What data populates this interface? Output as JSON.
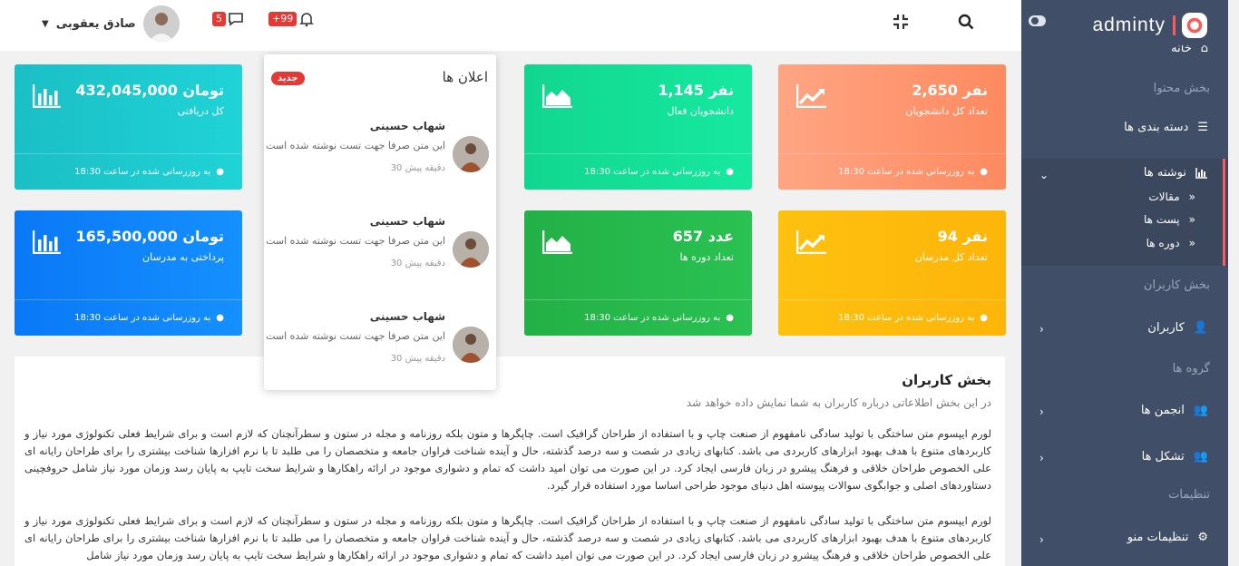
{
  "header": {
    "user_name": "صادق یعقوبی",
    "messages_count": "5",
    "notifications_count": "+99"
  },
  "sidebar": {
    "logo": "adminty",
    "home": "خانه",
    "section_content": "بخش محتوا",
    "categories": "دسته بندی ها",
    "posts": "نوشته ها",
    "sub_articles": "مقالات",
    "sub_posts": "پست ها",
    "sub_courses": "دوره ها",
    "section_users": "بخش کاربران",
    "users": "کاربران",
    "section_groups": "گروه ها",
    "forums": "انجمن ها",
    "organizations": "تشکل ها",
    "section_settings": "تنظیمات",
    "menu_settings": "تنظیمات منو"
  },
  "cards": [
    {
      "value": "432,045,000 تومان",
      "label": "کل دریافتی",
      "footer": "به روزرسانی شده در ساعت 18:30",
      "color": "#10c7cc"
    },
    {
      "value": "1,145 نفر",
      "label": "دانشجویان فعال",
      "footer": "به روزرسانی شده در ساعت 18:30",
      "color": "#13dd95"
    },
    {
      "value": "2,650 نفر",
      "label": "تعداد کل دانشجویان",
      "footer": "به روزرسانی شده در ساعت 18:30",
      "color": "#fd8f6a"
    },
    {
      "value": "165,500,000 تومان",
      "label": "پرداختی به مدرسان",
      "footer": "به روزرسانی شده در ساعت 18:30",
      "color": "#0c82fb"
    },
    {
      "value": "657 عدد",
      "label": "تعداد دوره ها",
      "footer": "به روزرسانی شده در ساعت 18:30",
      "color": "#26b74c"
    },
    {
      "value": "94 نفر",
      "label": "تعداد کل مدرسان",
      "footer": "به روزرسانی شده در ساعت 18:30",
      "color": "#fdb90c"
    }
  ],
  "panel": {
    "title": "بخش کاربران",
    "subtitle": "در این بخش اطلاعاتی درباره کاربران به شما نمایش داده خواهد شد",
    "paragraph1": "لورم ایپسوم متن ساختگی با تولید سادگی نامفهوم از صنعت چاپ و با استفاده از طراحان گرافیک است. چاپگرها و متون بلکه روزنامه و مجله در ستون و سطرآنچنان که لازم است و برای شرایط فعلی تکنولوژی مورد نیاز و کاربردهای متنوع با هدف بهبود ابزارهای کاربردی می باشد. کتابهای زیادی در شصت و سه درصد گذشته، حال و آینده شناخت فراوان جامعه و متخصصان را می طلبد تا با نرم افزارها شناخت بیشتری را برای طراحان رایانه ای علی الخصوص طراحان خلاقی و فرهنگ پیشرو در زبان فارسی ایجاد کرد. در این صورت می توان امید داشت که تمام و دشواری موجود در ارائه راهکارها و شرایط سخت تایپ به پایان رسد وزمان مورد نیاز شامل حروفچینی دستاوردهای اصلی و جوابگوی سوالات پیوسته اهل دنیای موجود طراحی اساسا مورد استفاده قرار گیرد.",
    "paragraph2": "لورم ایپسوم متن ساختگی با تولید سادگی نامفهوم از صنعت چاپ و با استفاده از طراحان گرافیک است. چاپگرها و متون بلکه روزنامه و مجله در ستون و سطرآنچنان که لازم است و برای شرایط فعلی تکنولوژی مورد نیاز و کاربردهای متنوع با هدف بهبود ابزارهای کاربردی می باشد. کتابهای زیادی در شصت و سه درصد گذشته، حال و آینده شناخت فراوان جامعه و متخصصان را می طلبد تا با نرم افزارها شناخت بیشتری را برای طراحان رایانه ای علی الخصوص طراحان خلاقی و فرهنگ پیشرو در زبان فارسی ایجاد کرد. در این صورت می توان امید داشت که تمام و دشواری موجود در ارائه راهکارها و شرایط سخت تایپ به پایان رسد وزمان مورد نیاز شامل"
  },
  "notifications": {
    "title": "اعلان ها",
    "badge": "جدید",
    "items": [
      {
        "name": "شهاب حسینی",
        "text": "این متن صرفا جهت تست نوشته شده است",
        "time": "30 دقیقه پیش"
      },
      {
        "name": "شهاب حسینی",
        "text": "این متن صرفا جهت تست نوشته شده است",
        "time": "30 دقیقه پیش"
      },
      {
        "name": "شهاب حسینی",
        "text": "این متن صرفا جهت تست نوشته شده است",
        "time": "30 دقیقه پیش"
      }
    ]
  }
}
